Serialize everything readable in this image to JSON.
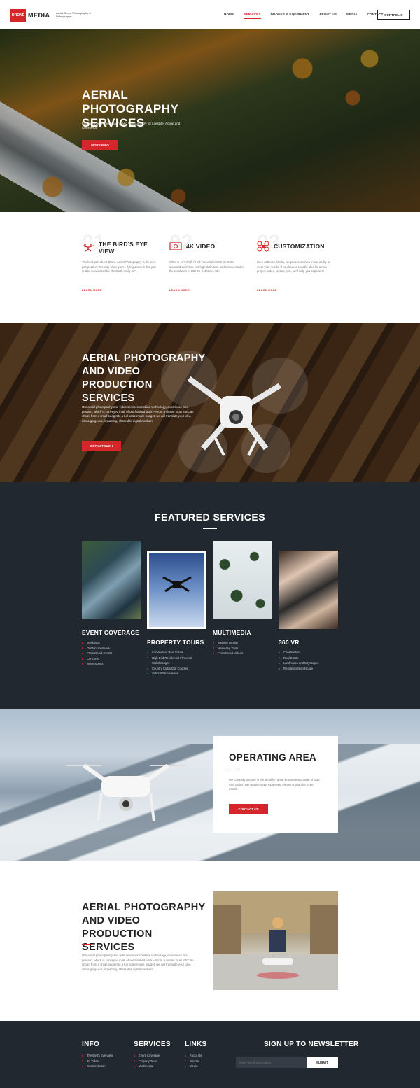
{
  "header": {
    "logo_box": "DRONE",
    "logo_word": "MEDIA",
    "tagline": "Aerial Drone Photography & Videography",
    "nav": [
      "HOME",
      "SERVICES",
      "DRONES & EQUIPMENT",
      "ABOUT US",
      "MEDIA",
      "CONTACT"
    ],
    "active_nav": "SERVICES",
    "portfolio": "PORTFOLIO"
  },
  "hero": {
    "title": "AERIAL PHOTOGRAPHY SERVICES",
    "subtitle": "Extreme Aerial Photography and Video Artistry for Lifestyle, Action and Commerce",
    "button": "MORE INFO"
  },
  "features": [
    {
      "number": "01",
      "icon": "drone-icon",
      "title": "THE BIRD'S EYE VIEW",
      "text": "The best part about Drone Aerial Photography is the new perspective! \"It's only when you're flying above it that you realize how incredible the Earth really is.\"",
      "link": "LEARN MORE"
    },
    {
      "number": "02",
      "icon": "camera-icon",
      "title": "4K VIDEO",
      "text": "What is 4K? Well, I'll tell you what it isn't! 4K is not standard definition, not high definition, and not even twice the resolution of HD! 4K is 4 times HD!",
      "link": "LEARN MORE"
    },
    {
      "number": "03",
      "icon": "quadcopter-icon",
      "title": "CUSTOMIZATION",
      "text": "Here at Drone Media, we pride ourselves in our ability to meet your needs. If you have a specific idea for a new project, video, picture, etc., we'll help you capture it!",
      "link": "LEARN MORE"
    }
  ],
  "production": {
    "title": "AERIAL PHOTOGRAPHY AND VIDEO PRODUCTION SERVICES",
    "text": "Our aerial photography and video services combine technology, experience and passion, which is conveyed in all of our finished work – From a simple to an intricate shoot, from a small budget to a full scale movie budget, we will translate your idea into a gorgeous, impacting, shareable digital medium!",
    "button": "GET IN TOUCH"
  },
  "featured": {
    "title": "FEATURED SERVICES",
    "services": [
      {
        "name": "EVENT COVERAGE",
        "items": [
          "Weddings",
          "Outdoor Festivals",
          "Promotional Events",
          "Concerts",
          "Team Sports"
        ]
      },
      {
        "name": "PROPERTY TOURS",
        "items": [
          "Commercial Real Estate",
          "High End Residential Flyovers/ Walkthroughs",
          "Country Clubs/Golf Courses",
          "Schools/Universities"
        ]
      },
      {
        "name": "MULTIMEDIA",
        "items": [
          "Website Design",
          "Marketing Tools",
          "Promotional Videos"
        ]
      },
      {
        "name": "360 VR",
        "items": [
          "Construction",
          "Real Estate",
          "Landmarks and Cityscapes",
          "Residential/Landscape"
        ]
      }
    ]
  },
  "operating": {
    "title": "OPERATING AREA",
    "text": "We currently operate in the Brooklyn area. Businesses outside of a 25 mile radius may require travel expenses. Please contact for more details.",
    "button": "CONTACT US"
  },
  "about": {
    "title": "AERIAL PHOTOGRAPHY AND VIDEO PRODUCTION SERVICES",
    "text": "Our aerial photography and video services combine technology, experience and passion, which is conveyed in all of our finished work – From a simple to an intricate shoot, from a small budget to a full scale movie budget, we will translate your idea into a gorgeous, impacting, shareable digital medium!"
  },
  "footer": {
    "info": {
      "title": "INFO",
      "items": [
        "The Bird's Eye View",
        "4K Video",
        "Customization"
      ]
    },
    "services": {
      "title": "SERVICES",
      "items": [
        "Event Coverage",
        "Property Tours",
        "Multimedia"
      ]
    },
    "links": {
      "title": "LINKS",
      "items": [
        "About Us",
        "Clients",
        "Media"
      ]
    },
    "newsletter": {
      "title": "SIGN UP TO NEWSLETTER",
      "placeholder": "Enter Your Email Address",
      "button": "SUBMIT"
    }
  },
  "colors": {
    "accent": "#d5262c",
    "dark": "#222830"
  }
}
